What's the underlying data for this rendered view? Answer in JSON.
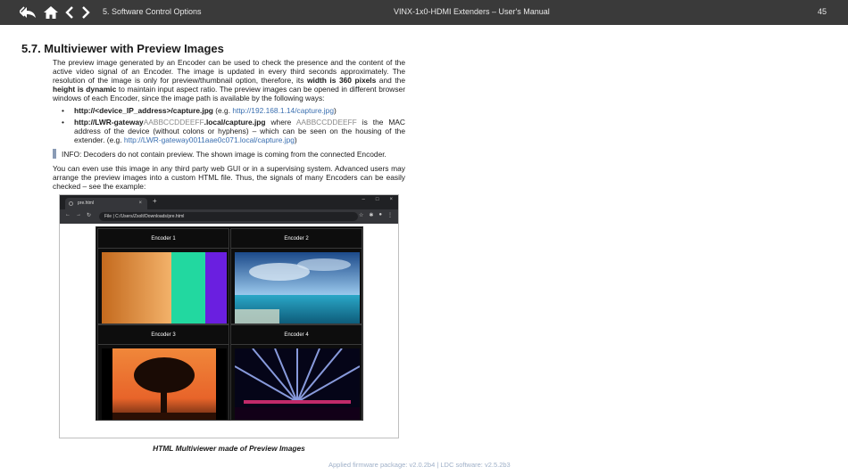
{
  "header": {
    "section": "5. Software Control Options",
    "doc_title": "VINX-1x0-HDMI Extenders – User's Manual",
    "page_number": "45",
    "icons": [
      "back-return-icon",
      "home-icon",
      "chevron-left-icon",
      "chevron-right-icon"
    ]
  },
  "heading": "5.7. Multiviewer with Preview Images",
  "para1": {
    "text": "The preview image generated by an Encoder can be used to check the presence and the content of the active video signal of an Encoder. The image is updated in every third seconds approximately. The resolution of the image is only for preview/thumbnail option, therefore, its ",
    "bold1": "width is 360 pixels",
    "mid": " and the ",
    "bold2": "height is dynamic",
    "end": " to maintain input aspect ratio. The preview images can be opened in different browser windows of each Encoder, since the image path is available by the following ways:"
  },
  "bullet1": {
    "path": "http://<device_IP_address>/capture.jpg",
    "eg_prefix": " (e.g. ",
    "example": "http://192.168.1.14/capture.jpg",
    "eg_suffix": ")"
  },
  "bullet2": {
    "path_a": "http://LWR-gateway",
    "path_mac": "AABBCCDDEEFF",
    "path_b": ".local/capture.jpg",
    "where": " where ",
    "mac": "AABBCCDDEEFF",
    "desc": " is the MAC address of the device (without colons or hyphens) – which can be seen on the housing of the extender. (e.g. ",
    "example": "http://LWR-gateway0011aae0c071.local/capture.jpg",
    "eg_suffix": ")"
  },
  "info": "INFO: Decoders do not contain preview. The shown image is coming from the connected Encoder.",
  "para2": "You can even use this image in any third party web GUI or in a supervising system. Advanced users may arrange the preview images into a custom HTML file. Thus, the signals of many Encoders can be easily checked – see the example:",
  "browser": {
    "tab_title": "pre.html",
    "tab_close": "×",
    "new_tab": "+",
    "address": "File  |  C:/Users/Zsolt/Downloads/pre.html",
    "win_minimize": "–",
    "win_maximize": "□",
    "win_close": "×"
  },
  "encoders": [
    {
      "label": "Encoder 1",
      "image": "color-bars"
    },
    {
      "label": "Encoder 2",
      "image": "sea-and-sky"
    },
    {
      "label": "Encoder 3",
      "image": "tree-at-sunset"
    },
    {
      "label": "Encoder 4",
      "image": "stage-light-show"
    }
  ],
  "caption": "HTML Multiviewer made of Preview Images",
  "footer": "Applied firmware package: v2.0.2b4    |    LDC software: v2.5.2b3"
}
